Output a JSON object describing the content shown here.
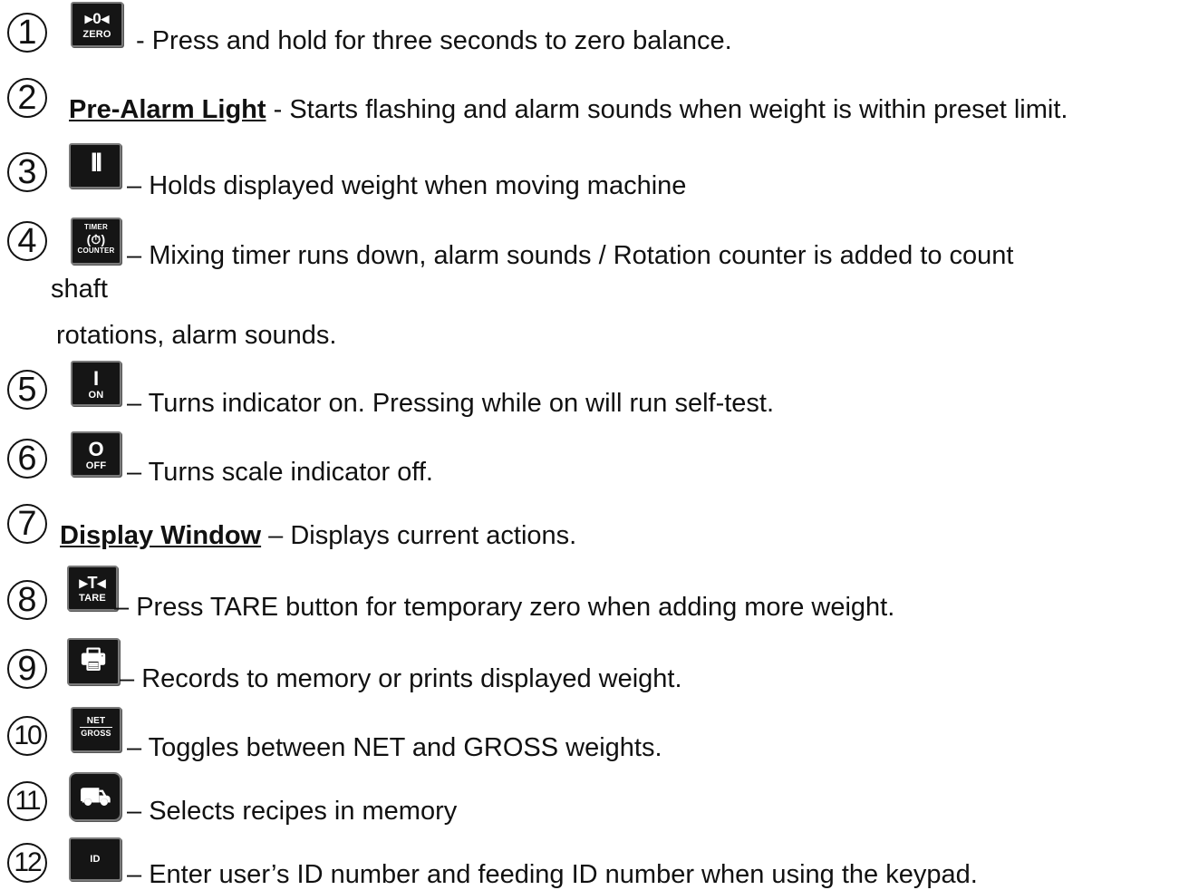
{
  "items": [
    {
      "num": "1",
      "icon": "zero-button-icon",
      "icon_text": [
        "▸0◂",
        "ZERO"
      ],
      "sep": " - ",
      "text": "Press and hold for three seconds to zero balance."
    },
    {
      "num": "2",
      "title": "Pre-Alarm Light",
      "sep": " - ",
      "text": "Starts flashing and alarm sounds when weight is within preset limit."
    },
    {
      "num": "3",
      "icon": "hold-pause-button-icon",
      "icon_text": [
        "II"
      ],
      "sep": " – ",
      "text": "Holds displayed weight when moving machine"
    },
    {
      "num": "4",
      "icon": "timer-counter-button-icon",
      "icon_text": [
        "TIMER",
        "(⏱)",
        "COUNTER"
      ],
      "sep": " – ",
      "text": "Mixing timer runs down, alarm sounds /  Rotation counter is added to count",
      "wrap": "shaft",
      "cont": "rotations, alarm sounds."
    },
    {
      "num": "5",
      "icon": "on-button-icon",
      "icon_text": [
        "I",
        "ON"
      ],
      "sep": " – ",
      "text": "Turns indicator on. Pressing while on will run self-test."
    },
    {
      "num": "6",
      "icon": "off-button-icon",
      "icon_text": [
        "O",
        "OFF"
      ],
      "sep": " – ",
      "text": "Turns scale indicator off."
    },
    {
      "num": "7",
      "title": "Display Window",
      "sep": " – ",
      "text": "Displays current actions."
    },
    {
      "num": "8",
      "icon": "tare-button-icon",
      "icon_text": [
        "▸T◂",
        "TARE"
      ],
      "sep": " – ",
      "text": "Press TARE button for temporary zero when adding more weight."
    },
    {
      "num": "9",
      "icon": "print-button-icon",
      "icon_text": [
        "🖶"
      ],
      "sep": " – ",
      "text": "Records to memory or prints displayed weight."
    },
    {
      "num": "10",
      "icon": "net-gross-button-icon",
      "icon_text": [
        "NET",
        "GROSS"
      ],
      "sep": " – ",
      "text": "Toggles between NET and GROSS weights."
    },
    {
      "num": "11",
      "icon": "recipe-mixer-button-icon",
      "icon_text": [
        "⛟"
      ],
      "sep": " – ",
      "text": "Selects recipes in memory"
    },
    {
      "num": "12",
      "icon": "id-button-icon",
      "icon_text": [
        "ID"
      ],
      "sep": " – ",
      "text": "Enter user’s ID number and feeding ID number when using the keypad."
    }
  ]
}
